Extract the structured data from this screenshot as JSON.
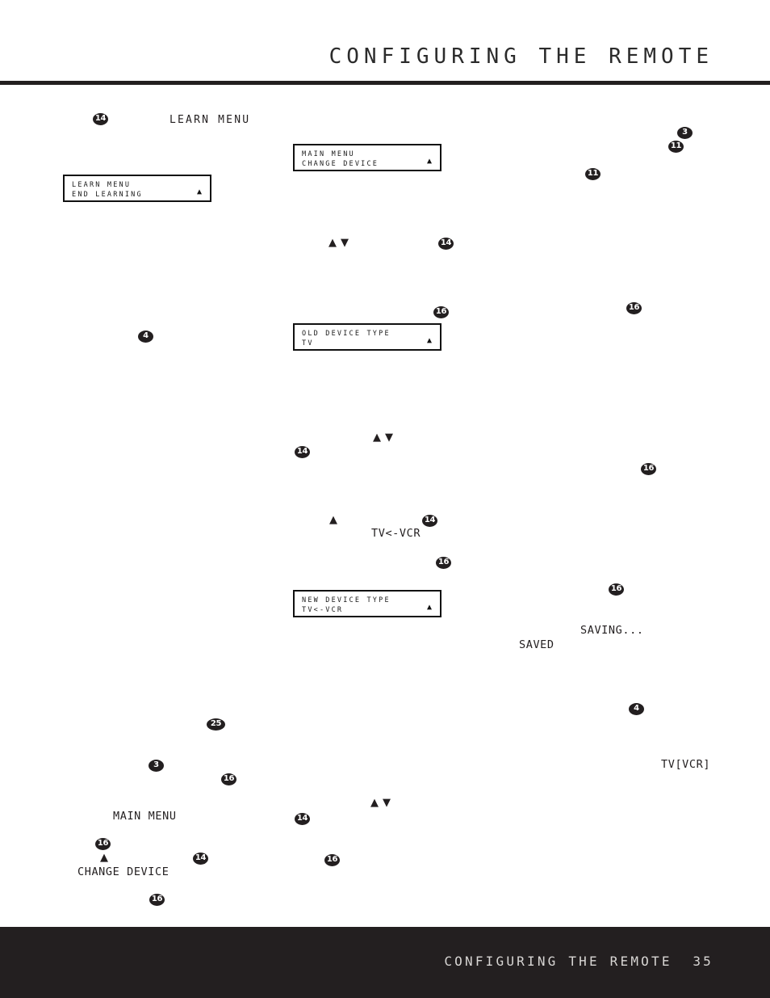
{
  "header": {
    "title": "CONFIGURING THE REMOTE"
  },
  "footer": {
    "title": "CONFIGURING THE REMOTE",
    "page_number": "35"
  },
  "colors": {
    "ink": "#231f20",
    "rule": "#231f20",
    "footer_bg": "#231f20",
    "footer_text": "#d8d6d4",
    "lcd_border": "#111111",
    "badge_bg": "#231f20",
    "badge_text": "#ffffff"
  },
  "lcd_screens": [
    {
      "id": "learn-menu-end-learning",
      "line1": "LEARN MENU",
      "line2": "END LEARNING",
      "arrow": "▲"
    },
    {
      "id": "main-menu-change-device",
      "line1": "MAIN MENU",
      "line2": "CHANGE DEVICE",
      "arrow": "▲"
    },
    {
      "id": "old-device-type-tv",
      "line1": "OLD DEVICE TYPE",
      "line2": "TV",
      "arrow": "▲"
    },
    {
      "id": "new-device-type-tv-vcr",
      "line1": "NEW DEVICE TYPE",
      "line2": "TV<-VCR",
      "arrow": "▲"
    }
  ],
  "display_labels": [
    {
      "id": "learn-menu",
      "text": "LEARN MENU"
    },
    {
      "id": "tv-left-vcr",
      "text": "TV<-VCR"
    },
    {
      "id": "saving",
      "text": "SAVING..."
    },
    {
      "id": "saved",
      "text": "SAVED"
    },
    {
      "id": "tv-bracket-vcr",
      "text": "TV[VCR]"
    },
    {
      "id": "main-menu",
      "text": "MAIN MENU"
    },
    {
      "id": "change-device",
      "text": "CHANGE DEVICE"
    }
  ],
  "arrow_glyphs": {
    "up": "▲",
    "down": "▼"
  },
  "callouts": [
    {
      "id": "c1",
      "number": "14"
    },
    {
      "id": "c2",
      "number": "3"
    },
    {
      "id": "c3",
      "number": "11"
    },
    {
      "id": "c4",
      "number": "11"
    },
    {
      "id": "c5",
      "number": "14"
    },
    {
      "id": "c6",
      "number": "16"
    },
    {
      "id": "c7",
      "number": "16"
    },
    {
      "id": "c8",
      "number": "4"
    },
    {
      "id": "c9",
      "number": "14"
    },
    {
      "id": "c10",
      "number": "16"
    },
    {
      "id": "c11",
      "number": "14"
    },
    {
      "id": "c12",
      "number": "16"
    },
    {
      "id": "c13",
      "number": "16"
    },
    {
      "id": "c14",
      "number": "25"
    },
    {
      "id": "c15",
      "number": "4"
    },
    {
      "id": "c16",
      "number": "3"
    },
    {
      "id": "c17",
      "number": "16"
    },
    {
      "id": "c18",
      "number": "16"
    },
    {
      "id": "c19",
      "number": "14"
    },
    {
      "id": "c20",
      "number": "14"
    },
    {
      "id": "c21",
      "number": "16"
    },
    {
      "id": "c22",
      "number": "16"
    }
  ]
}
